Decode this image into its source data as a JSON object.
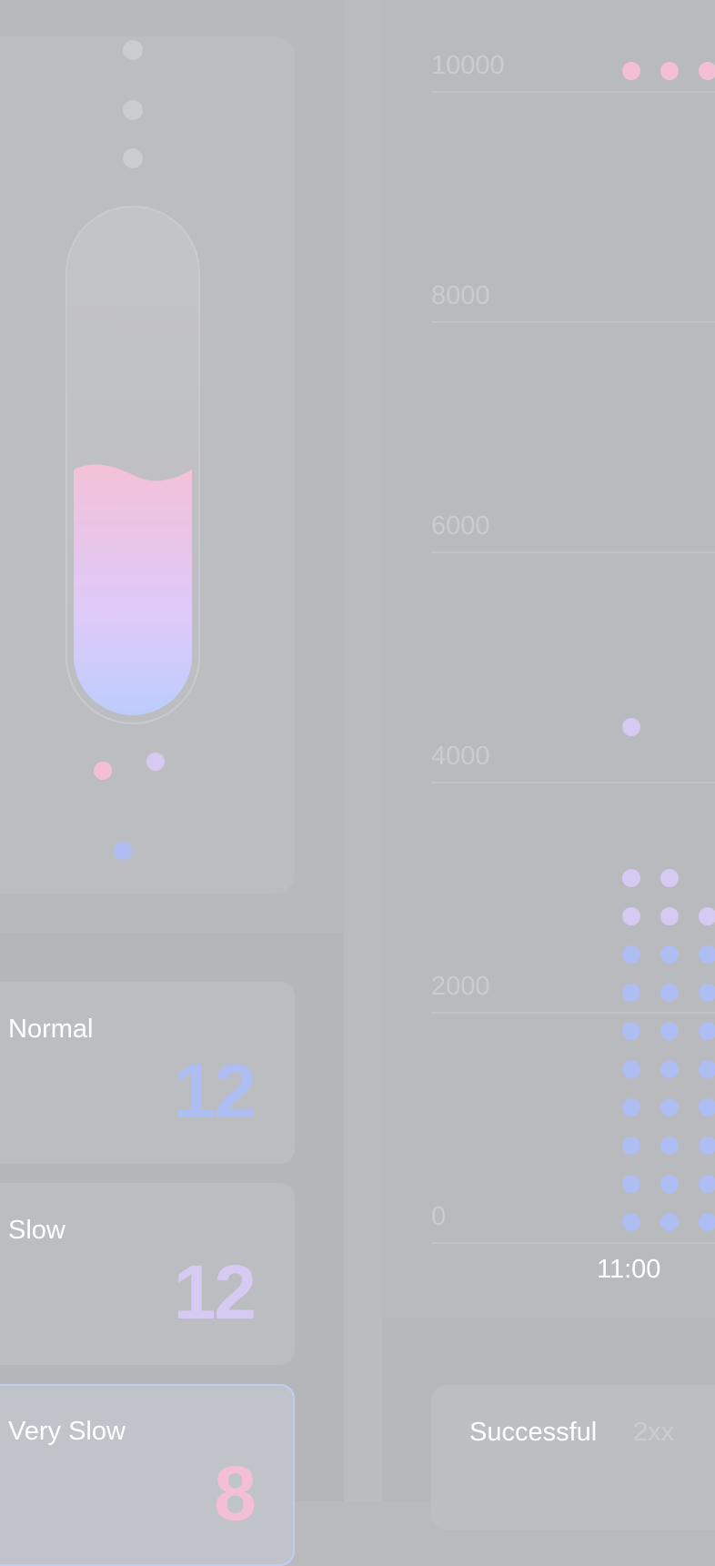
{
  "colors": {
    "normal": "#aebdf2",
    "slow": "#d6c9f2",
    "very_slow": "#f4bfd6",
    "gauge_dot": "#cbccd0"
  },
  "gauge": {
    "fill_level": 0.45
  },
  "stats": [
    {
      "label": "Normal",
      "value": "12"
    },
    {
      "label": "Slow",
      "value": "12"
    },
    {
      "label": "Very Slow",
      "value": "8"
    }
  ],
  "chart_data": {
    "type": "scatter",
    "ylim": [
      0,
      10000
    ],
    "y_ticks": [
      "10000",
      "8000",
      "6000",
      "4000",
      "2000",
      "0"
    ],
    "x_ticks": [
      "11:00"
    ],
    "columns": [
      {
        "x": "11:00",
        "normal_dots": 8,
        "slow_dots": 2,
        "outliers": [
          {
            "y": 10000,
            "kind": "very_slow"
          },
          {
            "y": 4300,
            "kind": "slow"
          }
        ]
      },
      {
        "x": "",
        "normal_dots": 8,
        "slow_dots": 2,
        "outliers": [
          {
            "y": 10000,
            "kind": "very_slow"
          }
        ]
      },
      {
        "x": "",
        "normal_dots": 8,
        "slow_dots": 1,
        "outliers": [
          {
            "y": 10000,
            "kind": "very_slow"
          }
        ]
      }
    ]
  },
  "filters": [
    {
      "label": "Successful",
      "code": "2xx"
    }
  ]
}
